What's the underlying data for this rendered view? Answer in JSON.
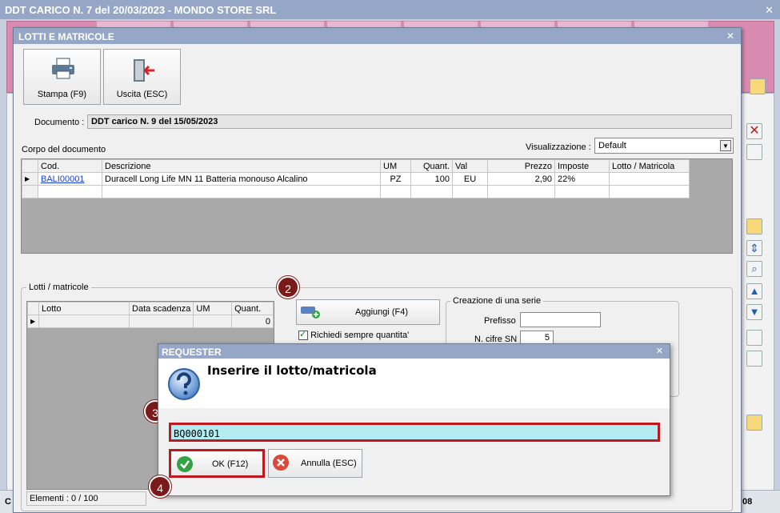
{
  "outer_window": {
    "title": "DDT CARICO N. 7 del 20/03/2023 - MONDO STORE SRL",
    "close": "✕"
  },
  "lotti_window": {
    "title": "LOTTI E MATRICOLE",
    "close": "✕"
  },
  "toolbar": {
    "print_label": "Stampa (F9)",
    "exit_label": "Uscita (ESC)"
  },
  "documento": {
    "label": "Documento :",
    "value": "DDT carico N. 9 del 15/05/2023"
  },
  "corpo": {
    "label": "Corpo del documento",
    "visualizzazione_label": "Visualizzazione :",
    "visualizzazione_value": "Default",
    "columns": [
      "Cod.",
      "Descrizione",
      "UM",
      "Quant.",
      "Val",
      "Prezzo",
      "Imposte",
      "Lotto / Matricola"
    ],
    "rows": [
      {
        "cod": "BALI00001",
        "descrizione": "Duracell Long Life MN 11 Batteria monouso Alcalino",
        "um": "PZ",
        "quant": "100",
        "val": "EU",
        "prezzo": "2,90",
        "imposte": "22%",
        "lotto": ""
      }
    ]
  },
  "lotti_matricole": {
    "label": "Lotti / matricole",
    "columns": [
      "Lotto",
      "Data scadenza",
      "UM",
      "Quant."
    ],
    "row_quant": "0",
    "elementi": "Elementi : 0 / 100"
  },
  "aggiungi": {
    "label": "Aggiungi (F4)",
    "richiedi_label": "Richiedi sempre quantita'"
  },
  "serie": {
    "title": "Creazione di una serie",
    "prefisso_label": "Prefisso",
    "ncifre_label": "N. cifre SN",
    "ncifre_value": "5"
  },
  "requester": {
    "title": "REQUESTER",
    "close": "✕",
    "message": "Inserire il lotto/matricola",
    "input_value": "BQ000101",
    "ok_label": "OK (F12)",
    "annulla_label": "Annulla (ESC)"
  },
  "badges": [
    "2",
    "3",
    "4"
  ],
  "bottom": {
    "left": "C",
    "right": "08"
  },
  "colors": {
    "titlebar": "#96a6c7",
    "highlight": "#c0181f",
    "pink": "#d88ab0",
    "input_bg": "#b3edf1"
  }
}
